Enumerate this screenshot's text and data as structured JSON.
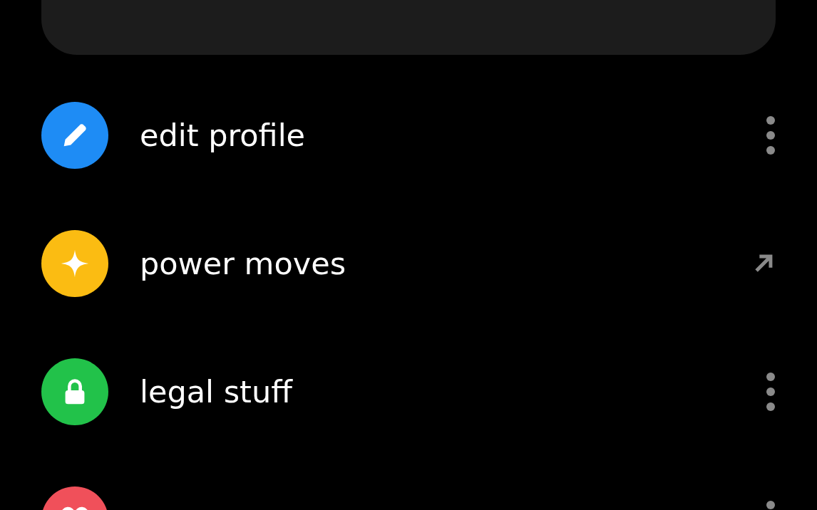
{
  "top_panel": {
    "kind": "card"
  },
  "menu_items": [
    {
      "label": "edit profile",
      "color": "#1e8cf5",
      "kind": "menu"
    },
    {
      "label": "power moves",
      "color": "#fbbc12",
      "kind": "link"
    },
    {
      "label": "legal stuff",
      "color": "#22c24a",
      "kind": "menu"
    },
    {
      "color": "#f0505a",
      "kind": "menu"
    }
  ]
}
